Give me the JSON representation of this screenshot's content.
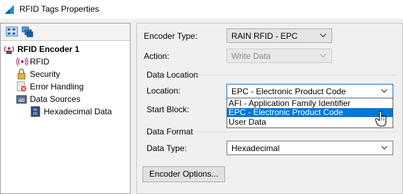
{
  "window": {
    "title": "RFID Tags Properties"
  },
  "tree": {
    "root": "RFID Encoder 1",
    "items": [
      {
        "label": "RFID",
        "icon": "rfid-waves-icon",
        "selected": true
      },
      {
        "label": "Security",
        "icon": "lock-icon"
      },
      {
        "label": "Error Handling",
        "icon": "error-page-icon"
      },
      {
        "label": "Data Sources",
        "icon": "data-source-icon"
      },
      {
        "label": "Hexadecimal Data",
        "icon": "hex-data-icon"
      }
    ]
  },
  "form": {
    "encoder_type_label": "Encoder Type:",
    "encoder_type_value": "RAIN RFID - EPC",
    "action_label": "Action:",
    "action_value": "Write Data",
    "data_location_title": "Data Location",
    "location_label": "Location:",
    "location_value": "EPC - Electronic Product Code",
    "location_options": [
      "AFI - Application Family Identifier",
      "EPC - Electronic Product Code",
      "User Data"
    ],
    "start_block_label": "Start Block:",
    "data_format_title": "Data Format",
    "data_type_label": "Data Type:",
    "data_type_value": "Hexadecimal",
    "encoder_options_button": "Encoder Options..."
  },
  "colors": {
    "accent": "#0078d7",
    "selection": "#0078d7"
  }
}
